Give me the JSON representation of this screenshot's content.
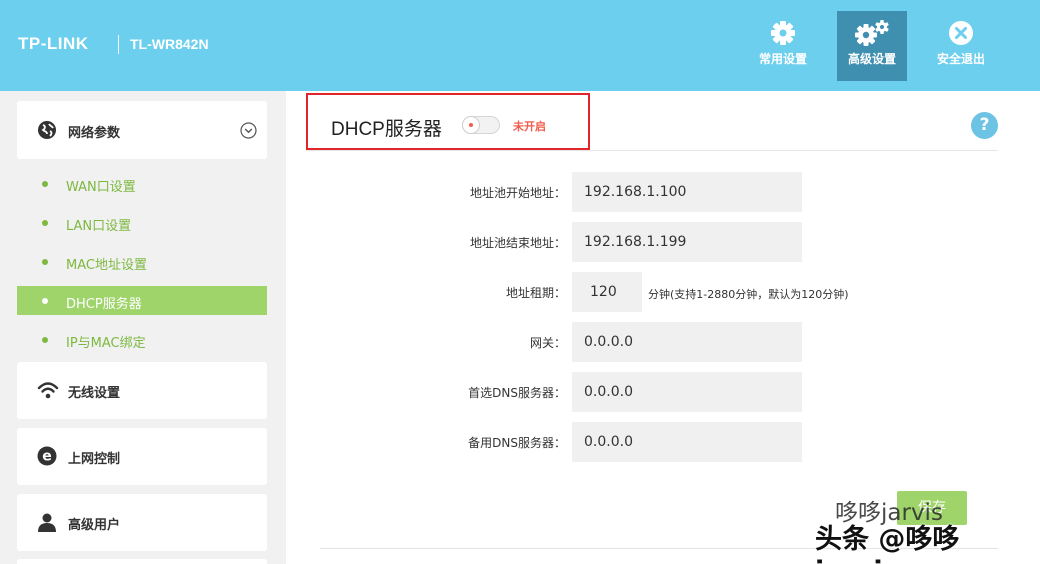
{
  "header": {
    "brand": "TP-LINK",
    "model": "TL-WR842N",
    "buttons": [
      {
        "label": "常用设置",
        "icon": "gear-icon"
      },
      {
        "label": "高级设置",
        "icon": "gears-icon",
        "active": true
      },
      {
        "label": "安全退出",
        "icon": "close-circle-icon"
      }
    ]
  },
  "sidebar": {
    "network": {
      "label": "网络参数",
      "icon": "globe-icon",
      "expand_icon": "chevron-down-circle-icon"
    },
    "items": [
      {
        "label": "WAN口设置"
      },
      {
        "label": "LAN口设置"
      },
      {
        "label": "MAC地址设置"
      },
      {
        "label": "DHCP服务器",
        "active": true
      },
      {
        "label": "IP与MAC绑定"
      }
    ],
    "sections": [
      {
        "label": "无线设置",
        "icon": "wifi-icon"
      },
      {
        "label": "上网控制",
        "icon": "e-icon"
      },
      {
        "label": "高级用户",
        "icon": "user-icon"
      }
    ]
  },
  "main": {
    "title": "DHCP服务器",
    "toggle_status": "未开启",
    "help": "?",
    "fields": {
      "pool_start": {
        "label": "地址池开始地址：",
        "value": "192.168.1.100"
      },
      "pool_end": {
        "label": "地址池结束地址：",
        "value": "192.168.1.199"
      },
      "lease": {
        "label": "地址租期：",
        "value": "120",
        "hint": "分钟(支持1-2880分钟，默认为120分钟)"
      },
      "gateway": {
        "label": "网关：",
        "value": "0.0.0.0"
      },
      "dns_primary": {
        "label": "首选DNS服务器：",
        "value": "0.0.0.0"
      },
      "dns_secondary": {
        "label": "备用DNS服务器：",
        "value": "0.0.0.0"
      }
    },
    "save_label": "保存"
  },
  "watermark": {
    "line1": "哆哆jarvis",
    "line2": "头条 @哆哆jarvis"
  },
  "colors": {
    "header_bg": "#6dcfee",
    "active_header_btn": "#3f8fb1",
    "accent_green": "#9fd46b",
    "sub_text_green": "#7db83f",
    "status_red": "#f25d4b",
    "highlight_red": "#e0262b"
  }
}
